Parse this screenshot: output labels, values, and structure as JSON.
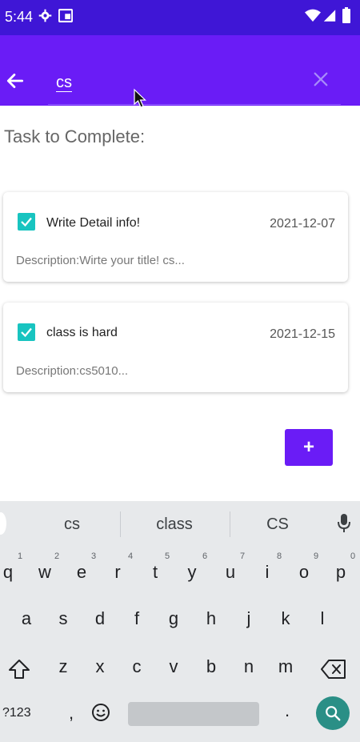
{
  "status": {
    "time": "5:44"
  },
  "appbar": {
    "search_value": "cs"
  },
  "section_title": "Task to Complete:",
  "tasks": [
    {
      "title": "Write Detail info!",
      "date": "2021-12-07",
      "description": "Description:Wirte your title! cs..."
    },
    {
      "title": "class is hard",
      "date": "2021-12-15",
      "description": "Description:cs5010..."
    }
  ],
  "fab_label": "+",
  "keyboard": {
    "suggestions": [
      "cs",
      "class",
      "CS"
    ],
    "row1": [
      "q",
      "w",
      "e",
      "r",
      "t",
      "y",
      "u",
      "i",
      "o",
      "p"
    ],
    "row1_hints": [
      "1",
      "2",
      "3",
      "4",
      "5",
      "6",
      "7",
      "8",
      "9",
      "0"
    ],
    "row2": [
      "a",
      "s",
      "d",
      "f",
      "g",
      "h",
      "j",
      "k",
      "l"
    ],
    "row3": [
      "z",
      "x",
      "c",
      "v",
      "b",
      "n",
      "m"
    ],
    "symbols_key": "?123",
    "comma_key": ",",
    "period_key": "."
  },
  "colors": {
    "status_bar": "#3f16d6",
    "app_bar": "#6a1cf6",
    "checkbox": "#18c4c0",
    "fab": "#6a1cf6",
    "keyboard_bg": "#e7e9eb",
    "search_key": "#2a8f86"
  },
  "icons": {
    "status": [
      "gear-icon",
      "sim-card-icon",
      "wifi-icon",
      "signal-icon",
      "battery-icon"
    ],
    "back": "arrow-left-icon",
    "clear": "close-icon",
    "mic": "microphone-icon",
    "shift": "shift-icon",
    "backspace": "backspace-icon",
    "emoji": "emoji-icon",
    "search": "search-icon"
  }
}
